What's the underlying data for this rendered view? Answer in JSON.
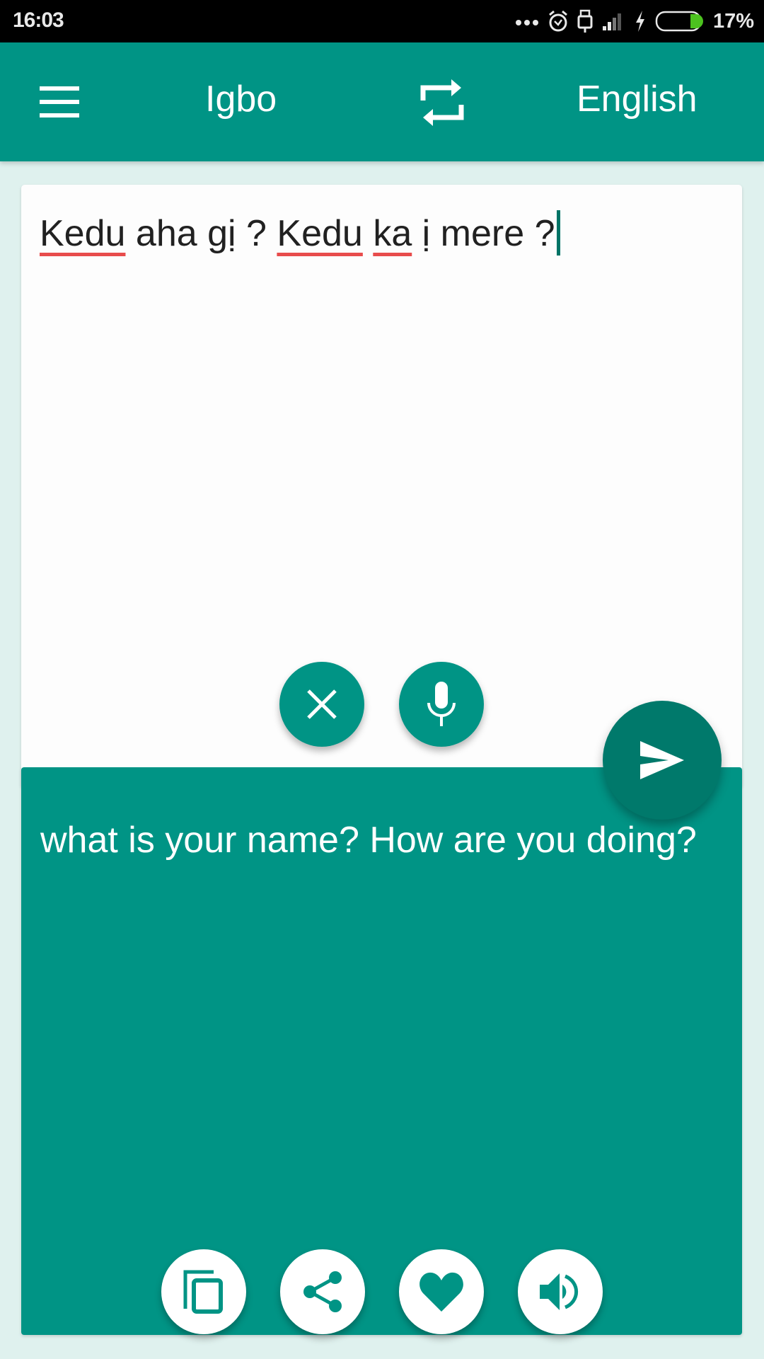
{
  "status_bar": {
    "time": "16:03",
    "icons": [
      "more-dots-icon",
      "alarm-icon",
      "usb-icon",
      "signal-icon",
      "charging-icon",
      "battery-icon"
    ],
    "battery_percent": "17%",
    "battery_level": 0.17,
    "battery_color": "#4cc21f"
  },
  "toolbar": {
    "menu_icon": "hamburger-menu-icon",
    "source_language": "Igbo",
    "swap_icon": "swap-languages-icon",
    "target_language": "English",
    "background_color": "#009485"
  },
  "input": {
    "words": [
      {
        "text": "Kedu",
        "misspelled": true
      },
      {
        "text": " aha gị ? ",
        "misspelled": false
      },
      {
        "text": "Kedu",
        "misspelled": true
      },
      {
        "text": " ",
        "misspelled": false
      },
      {
        "text": "ka",
        "misspelled": true
      },
      {
        "text": " ị mere ?",
        "misspelled": false
      }
    ],
    "full_text": "Kedu aha gị ? Kedu ka ị mere ?",
    "clear_icon": "close-icon",
    "mic_icon": "microphone-icon"
  },
  "send": {
    "icon": "send-icon",
    "color": "#00796b"
  },
  "output": {
    "text": "what is your name? How are you doing?",
    "actions": [
      {
        "name": "copy",
        "icon": "copy-icon"
      },
      {
        "name": "share",
        "icon": "share-icon"
      },
      {
        "name": "favorite",
        "icon": "heart-icon"
      },
      {
        "name": "speak",
        "icon": "speaker-icon"
      }
    ]
  },
  "colors": {
    "accent": "#009485",
    "background": "#dff1ee",
    "spellcheck_underline": "#e84c4c"
  }
}
